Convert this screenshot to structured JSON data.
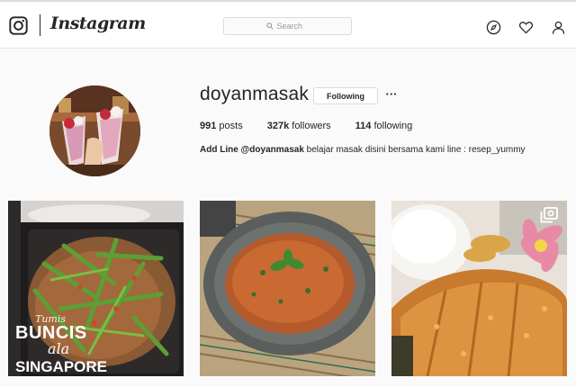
{
  "header": {
    "logo_icon": "instagram-camera-icon",
    "wordmark": "Instagram",
    "search_placeholder": "Search",
    "nav_icons": [
      "compass-icon",
      "heart-icon",
      "person-icon"
    ]
  },
  "profile": {
    "username": "doyanmasak",
    "follow_button": "Following",
    "more_button": "···",
    "stats": {
      "posts_count": "991",
      "posts_label": " posts",
      "followers_count": "327k",
      "followers_label": " followers",
      "following_count": "114",
      "following_label": " following"
    },
    "bio_bold": "Add Line @doyanmasak",
    "bio_text": " belajar masak disini bersama kami line : resep_yummy"
  },
  "posts": [
    {
      "caption_small": "Tumis",
      "caption_line1": "BUNCIS",
      "caption_line2": "ala",
      "caption_line3": "SINGAPORE"
    },
    {},
    {
      "badge_icon": "multiple-photos-icon"
    }
  ],
  "colors": {
    "text": "#262626",
    "border": "#dbdbdb",
    "background": "#fafafa"
  }
}
